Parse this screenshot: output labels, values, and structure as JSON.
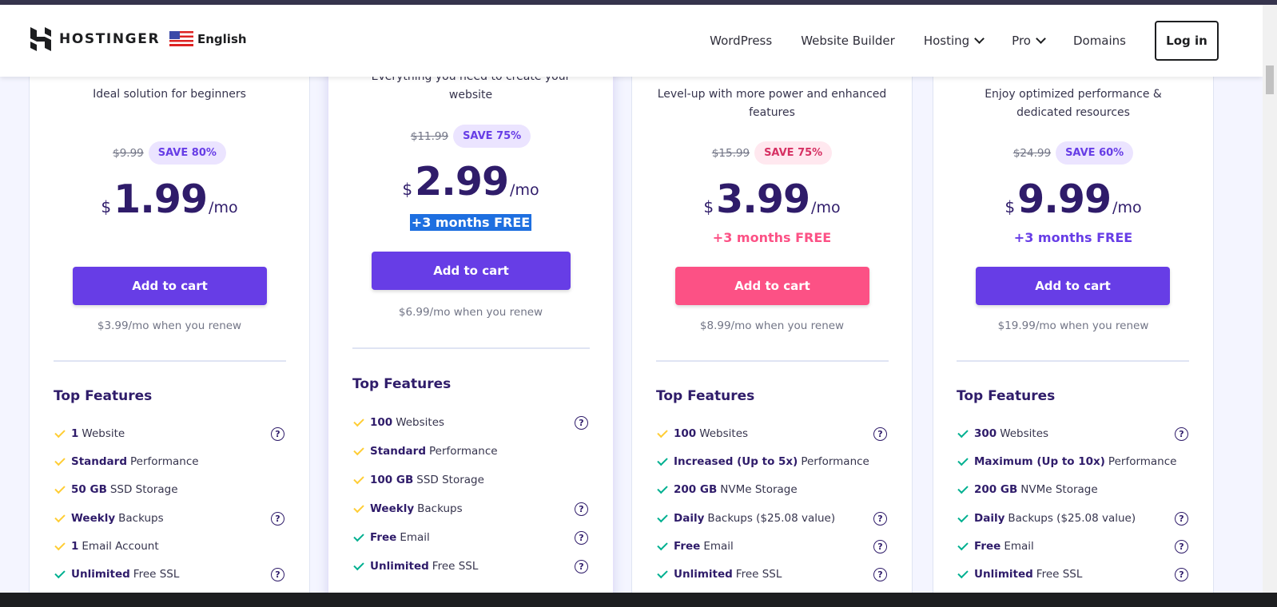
{
  "header": {
    "brand": "HOSTINGER",
    "language": "English",
    "nav": [
      {
        "label": "WordPress"
      },
      {
        "label": "Website Builder"
      },
      {
        "label": "Hosting",
        "dropdown": true
      },
      {
        "label": "Pro",
        "dropdown": true
      },
      {
        "label": "Domains"
      }
    ],
    "login_label": "Log in"
  },
  "plans": [
    {
      "description": "Ideal solution for beginners",
      "old_price": "$9.99",
      "save_badge": "SAVE 80%",
      "currency": "$",
      "price": "1.99",
      "period": "/mo",
      "bonus": "",
      "button": "Add to cart",
      "renew": "$3.99/mo when you renew",
      "features_title": "Top Features",
      "features": [
        {
          "bold": "1",
          "text": "Website",
          "check": "yellow",
          "help": true
        },
        {
          "bold": "Standard",
          "text": "Performance",
          "check": "yellow",
          "help": false
        },
        {
          "bold": "50 GB",
          "text": "SSD Storage",
          "check": "yellow",
          "help": false
        },
        {
          "bold": "Weekly",
          "text": "Backups",
          "check": "yellow",
          "help": true
        },
        {
          "bold": "1",
          "text": "Email Account",
          "check": "yellow",
          "help": false
        },
        {
          "bold": "Unlimited",
          "text": "Free SSL",
          "check": "green",
          "help": true
        }
      ]
    },
    {
      "description": "Everything you need to create your website",
      "old_price": "$11.99",
      "save_badge": "SAVE 75%",
      "currency": "$",
      "price": "2.99",
      "period": "/mo",
      "bonus": "+3 months FREE",
      "button": "Add to cart",
      "renew": "$6.99/mo when you renew",
      "features_title": "Top Features",
      "features": [
        {
          "bold": "100",
          "text": "Websites",
          "check": "yellow",
          "help": true
        },
        {
          "bold": "Standard",
          "text": "Performance",
          "check": "yellow",
          "help": false
        },
        {
          "bold": "100 GB",
          "text": "SSD Storage",
          "check": "yellow",
          "help": false
        },
        {
          "bold": "Weekly",
          "text": "Backups",
          "check": "yellow",
          "help": true
        },
        {
          "bold": "Free",
          "text": "Email",
          "check": "green",
          "help": true
        },
        {
          "bold": "Unlimited",
          "text": "Free SSL",
          "check": "green",
          "help": true
        }
      ]
    },
    {
      "description": "Level-up with more power and enhanced features",
      "old_price": "$15.99",
      "save_badge": "SAVE 75%",
      "currency": "$",
      "price": "3.99",
      "period": "/mo",
      "bonus": "+3 months FREE",
      "button": "Add to cart",
      "renew": "$8.99/mo when you renew",
      "features_title": "Top Features",
      "features": [
        {
          "bold": "100",
          "text": "Websites",
          "check": "yellow",
          "help": true
        },
        {
          "bold": "Increased (Up to 5x)",
          "text": "Performance",
          "check": "green",
          "help": false
        },
        {
          "bold": "200 GB",
          "text": "NVMe Storage",
          "check": "green",
          "help": false
        },
        {
          "bold": "Daily",
          "text": "Backups ($25.08 value)",
          "check": "green",
          "help": true
        },
        {
          "bold": "Free",
          "text": "Email",
          "check": "green",
          "help": true
        },
        {
          "bold": "Unlimited",
          "text": "Free SSL",
          "check": "green",
          "help": true
        }
      ]
    },
    {
      "description": "Enjoy optimized performance & dedicated resources",
      "old_price": "$24.99",
      "save_badge": "SAVE 60%",
      "currency": "$",
      "price": "9.99",
      "period": "/mo",
      "bonus": "+3 months FREE",
      "button": "Add to cart",
      "renew": "$19.99/mo when you renew",
      "features_title": "Top Features",
      "features": [
        {
          "bold": "300",
          "text": "Websites",
          "check": "green",
          "help": true
        },
        {
          "bold": "Maximum (Up to 10x)",
          "text": "Performance",
          "check": "green",
          "help": false
        },
        {
          "bold": "200 GB",
          "text": "NVMe Storage",
          "check": "green",
          "help": false
        },
        {
          "bold": "Daily",
          "text": "Backups ($25.08 value)",
          "check": "green",
          "help": true
        },
        {
          "bold": "Free",
          "text": "Email",
          "check": "green",
          "help": true
        },
        {
          "bold": "Unlimited",
          "text": "Free SSL",
          "check": "green",
          "help": true
        }
      ]
    }
  ],
  "colors": {
    "primary": "#673de6",
    "pink": "#fc5185",
    "navy": "#2f1c6a",
    "selection": "#1e6fe0"
  }
}
